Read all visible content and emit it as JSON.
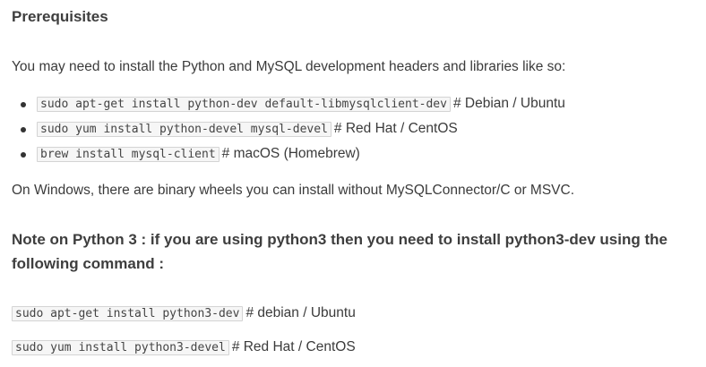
{
  "section": {
    "heading": "Prerequisites",
    "intro": "You may need to install the Python and MySQL development headers and libraries like so:",
    "install_list": [
      {
        "command": "sudo apt-get install python-dev default-libmysqlclient-dev",
        "comment": "# Debian / Ubuntu"
      },
      {
        "command": "sudo yum install python-devel mysql-devel",
        "comment": "# Red Hat / CentOS"
      },
      {
        "command": "brew install mysql-client",
        "comment": "# macOS (Homebrew)"
      }
    ],
    "windows_note": "On Windows, there are binary wheels you can install without MySQLConnector/C or MSVC."
  },
  "python3_note": {
    "heading": "Note on Python 3 : if you are using python3 then you need to install python3-dev using the following command :",
    "commands": [
      {
        "command": "sudo apt-get install python3-dev",
        "comment": "# debian / Ubuntu"
      },
      {
        "command": "sudo yum install python3-devel",
        "comment": "# Red Hat / CentOS"
      }
    ]
  }
}
